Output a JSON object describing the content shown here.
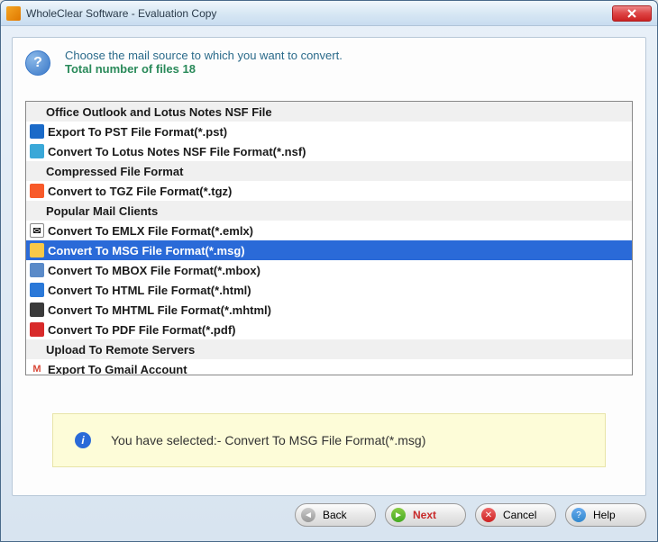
{
  "window": {
    "title": "WholeClear Software - Evaluation Copy"
  },
  "header": {
    "prompt": "Choose the mail source to which you want to convert.",
    "file_count_label": "Total number of files 18"
  },
  "list": {
    "groups": [
      {
        "heading": "Office Outlook and Lotus Notes NSF File",
        "items": [
          {
            "icon": "pst",
            "label": "Export To PST File Format(*.pst)"
          },
          {
            "icon": "nsf",
            "label": "Convert To Lotus Notes NSF File Format(*.nsf)"
          }
        ]
      },
      {
        "heading": "Compressed File Format",
        "items": [
          {
            "icon": "tgz",
            "label": "Convert to TGZ File Format(*.tgz)"
          }
        ]
      },
      {
        "heading": "Popular Mail Clients",
        "items": [
          {
            "icon": "emlx",
            "label": "Convert To EMLX File Format(*.emlx)"
          },
          {
            "icon": "msg",
            "label": "Convert To MSG File Format(*.msg)",
            "selected": true
          },
          {
            "icon": "mbox",
            "label": "Convert To MBOX File Format(*.mbox)"
          },
          {
            "icon": "html",
            "label": "Convert To HTML File Format(*.html)"
          },
          {
            "icon": "mhtml",
            "label": "Convert To MHTML File Format(*.mhtml)"
          },
          {
            "icon": "pdf",
            "label": "Convert To PDF File Format(*.pdf)"
          }
        ]
      },
      {
        "heading": "Upload To Remote Servers",
        "items": [
          {
            "icon": "gmail",
            "label": "Export To Gmail Account"
          }
        ]
      }
    ]
  },
  "status": {
    "message": "You have selected:- Convert To MSG File Format(*.msg)"
  },
  "buttons": {
    "back": "Back",
    "next": "Next",
    "cancel": "Cancel",
    "help": "Help"
  }
}
